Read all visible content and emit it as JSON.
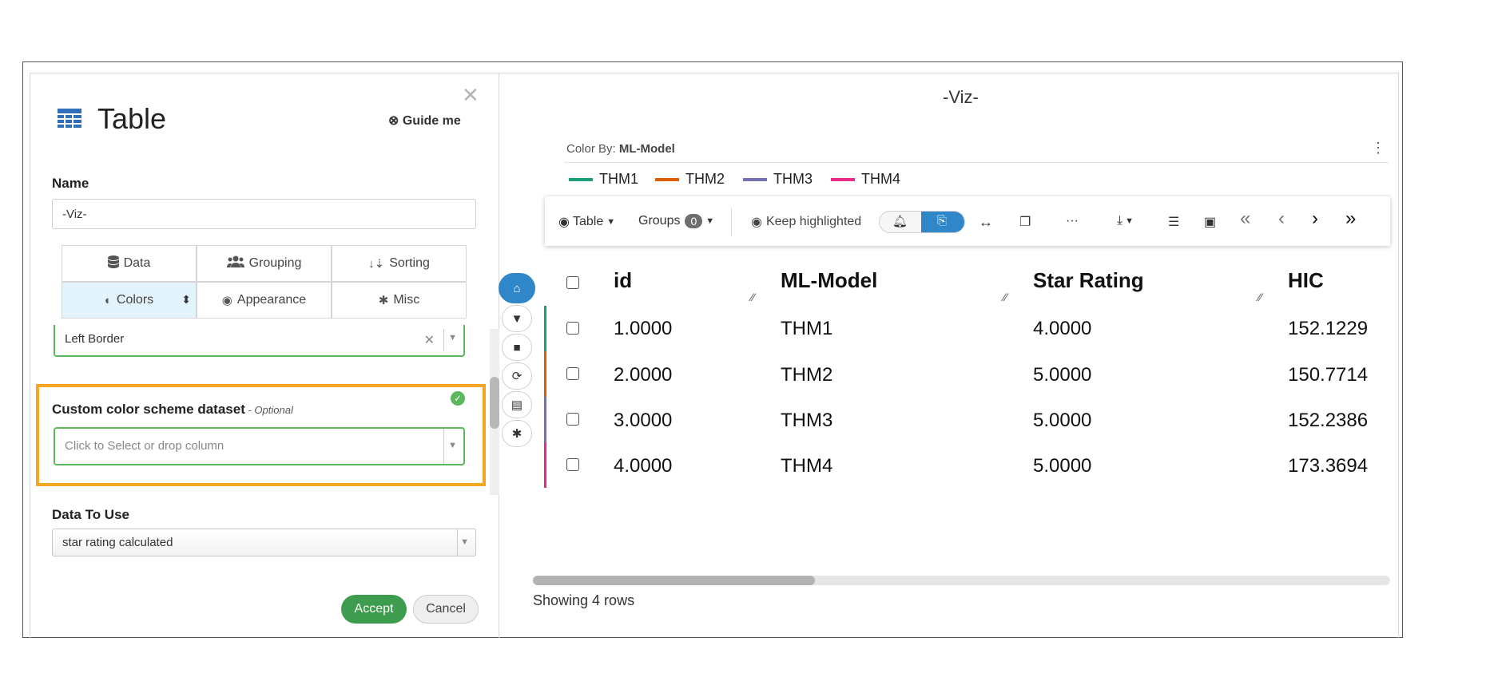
{
  "panel": {
    "title": "Table",
    "guide_label": "Guide me",
    "close_icon": "✕",
    "name_label": "Name",
    "name_value": "-Viz-",
    "tabs": [
      {
        "label": "Data",
        "icon": "database-icon"
      },
      {
        "label": "Grouping",
        "icon": "users-icon"
      },
      {
        "label": "Sorting",
        "icon": "sort-icon"
      },
      {
        "label": "Colors",
        "icon": "contrast-icon"
      },
      {
        "label": "Appearance",
        "icon": "eye-icon"
      },
      {
        "label": "Misc",
        "icon": "gear-icon"
      }
    ],
    "color_mode_value": "Left Border",
    "custom_scheme_label": "Custom color scheme dataset",
    "custom_scheme_optional": " - Optional",
    "custom_scheme_placeholder": "Click to Select or drop column",
    "data_to_use_label": "Data To Use",
    "data_to_use_value": "star rating calculated",
    "accept_label": "Accept",
    "cancel_label": "Cancel"
  },
  "viz": {
    "title": "-Viz-",
    "color_by_prefix": "Color By: ",
    "color_by_value": "ML-Model",
    "legend": [
      {
        "label": "THM1",
        "color": "#1b9e77"
      },
      {
        "label": "THM2",
        "color": "#d95f02"
      },
      {
        "label": "THM3",
        "color": "#7570b3"
      },
      {
        "label": "THM4",
        "color": "#e7298a"
      }
    ],
    "toolbar": {
      "view_label": "Table",
      "groups_label": "Groups",
      "groups_count": "0",
      "keep_highlighted_label": "Keep highlighted"
    },
    "columns": [
      "id",
      "ML-Model",
      "Star Rating",
      "HIC"
    ],
    "rows": [
      {
        "id": "1.0000",
        "model": "THM1",
        "rating": "4.0000",
        "hic": "152.1229",
        "color": "#1b9e77"
      },
      {
        "id": "2.0000",
        "model": "THM2",
        "rating": "5.0000",
        "hic": "150.7714",
        "color": "#d95f02"
      },
      {
        "id": "3.0000",
        "model": "THM3",
        "rating": "5.0000",
        "hic": "152.2386",
        "color": "#7570b3"
      },
      {
        "id": "4.0000",
        "model": "THM4",
        "rating": "5.0000",
        "hic": "173.3694",
        "color": "#e7298a"
      }
    ],
    "status": "Showing 4 rows"
  }
}
